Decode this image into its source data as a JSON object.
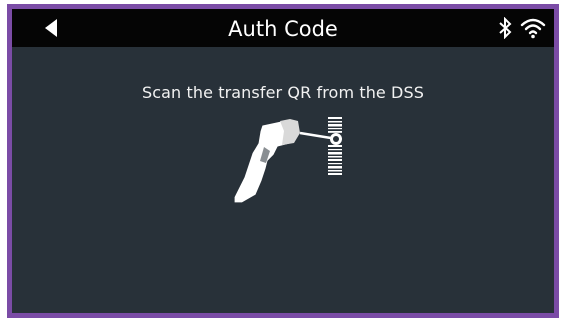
{
  "header": {
    "title": "Auth Code",
    "back_icon": "back-arrow-icon",
    "status_icons": [
      "bluetooth-icon",
      "wifi-icon"
    ]
  },
  "main": {
    "instruction": "Scan the transfer QR from the DSS",
    "illustration": "barcode-scanner-icon"
  },
  "colors": {
    "frame_border": "#7b4ca6",
    "background": "#283139",
    "titlebar": "#050505",
    "text": "#ffffff"
  }
}
